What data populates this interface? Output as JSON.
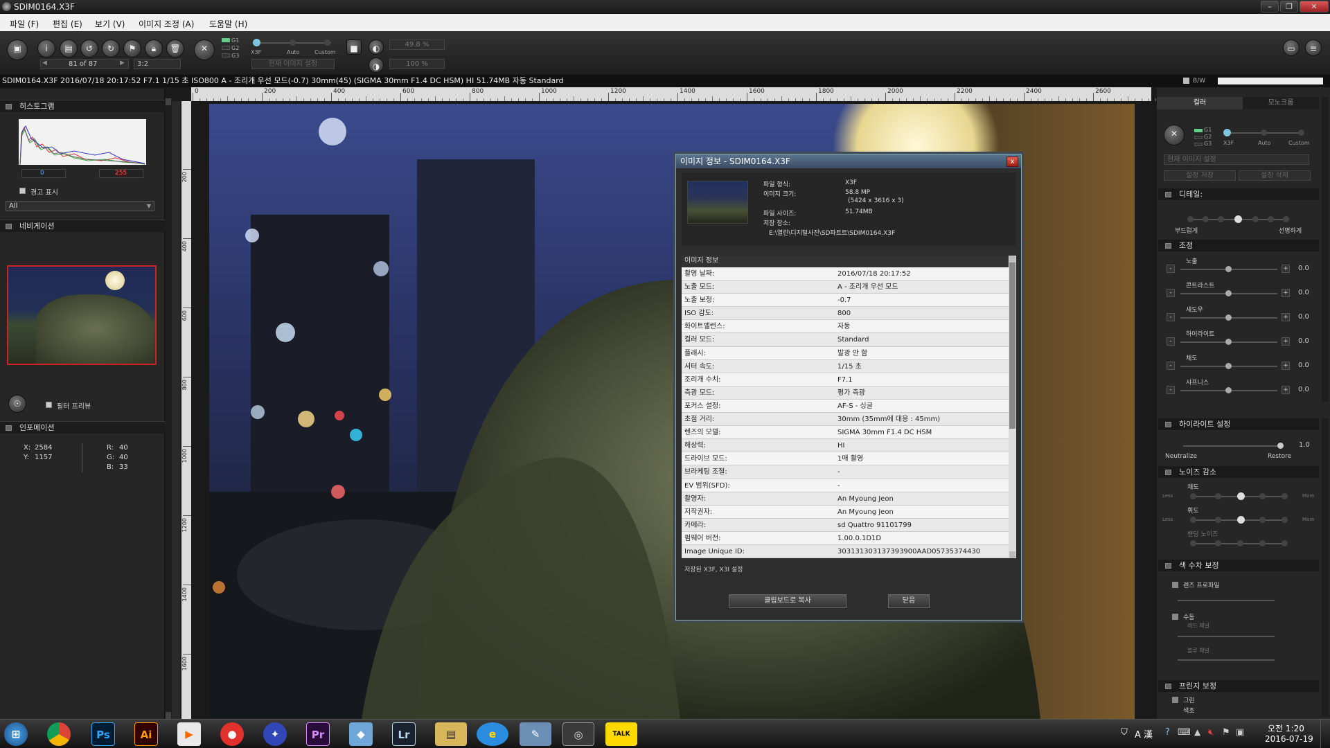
{
  "window": {
    "title": "SDIM0164.X3F"
  },
  "menu": [
    "파일 (F)",
    "편집 (E)",
    "보기 (V)",
    "이미지 조정 (A)",
    "도움말 (H)"
  ],
  "toolbar": {
    "counter": "81 of 87",
    "ratio": "3:2",
    "g_labels": [
      "G1",
      "G2",
      "G3"
    ],
    "mode_labels": [
      "X3F",
      "Auto",
      "Custom"
    ],
    "preset": "현재 이미지 설정",
    "zoom1": "49.8 %",
    "zoom2": "100 %"
  },
  "infostrip": "SDIM0164.X3F 2016/07/18 20:17:52 F7.1 1/15 초 ISO800 A - 조리개 우선 모드(-0.7) 30mm(45) (SIGMA 30mm F1.4 DC HSM) HI 51.74MB 자동 Standard",
  "infostrip_right": "B/W",
  "left": {
    "histogram_title": "히스토그램",
    "hist_min": "0",
    "hist_max": "255",
    "warning_label": "경고 표시",
    "channel_select": "All",
    "navigation_title": "네비게이션",
    "filter_preview": "필터 프리뷰",
    "information_title": "인포메이션",
    "x_label": "X:",
    "x": "2584",
    "y_label": "Y:",
    "y": "1157",
    "r_label": "R:",
    "r": "40",
    "g_label": "G:",
    "g": "40",
    "b_label": "B:",
    "b": "33"
  },
  "ruler": {
    "top": [
      "0",
      "200",
      "400",
      "600",
      "800",
      "1000",
      "1200",
      "1400",
      "1600",
      "1800",
      "2000",
      "2200",
      "2400",
      "2600"
    ],
    "left": [
      "200",
      "400",
      "600",
      "800",
      "1000",
      "1200",
      "1400",
      "1600"
    ]
  },
  "right": {
    "tab_color": "컬러",
    "tab_mono": "모노크롬",
    "preset": "현재 이미지 설정",
    "save_btn": "설정 저장",
    "delete_btn": "설정 삭제",
    "detail_title": "디테일:",
    "soft_label": "부드럽게",
    "sharp_label": "선명하게",
    "adjust_title": "조정",
    "sliders": [
      {
        "label": "노출",
        "value": "0.0"
      },
      {
        "label": "콘트라스트",
        "value": "0.0"
      },
      {
        "label": "섀도우",
        "value": "0.0"
      },
      {
        "label": "하이라이트",
        "value": "0.0"
      },
      {
        "label": "채도",
        "value": "0.0"
      },
      {
        "label": "샤프니스",
        "value": "0.0"
      }
    ],
    "highlight_title": "하이라이트 설정",
    "highlight_value": "1.0",
    "neutralize": "Neutralize",
    "restore": "Restore",
    "noise_title": "노이즈 감소",
    "noise_chroma": "채도",
    "noise_luma": "휘도",
    "noise_banding": "밴딩 노이즈",
    "less": "Less",
    "more": "More",
    "color_corr_title": "색 수차 보정",
    "lens_profile": "렌즈 프로파일",
    "manual": "수동",
    "red_channel": "레드 채널",
    "blue_channel": "블루 채널",
    "fringe_title": "프린지 보정",
    "green": "그린",
    "color_word": "색조"
  },
  "dialog": {
    "title": "이미지 정보 - SDIM0164.X3F",
    "close": "x",
    "format_label": "파일 형식:",
    "format": "X3F",
    "size_label": "이미지 크기:",
    "size": "58.8 MP",
    "size2": "(5424 x 3616 x 3)",
    "filesize_label": "파일 사이즈:",
    "filesize": "51.74MB",
    "location_label": "저장 장소:",
    "location": "E:\\열린\\디지털사진\\SD파트트\\SDIM0164.X3F",
    "section": "이미지 정보",
    "rows": [
      {
        "k": "촬영 날짜:",
        "v": "2016/07/18 20:17:52"
      },
      {
        "k": "노출 모드:",
        "v": "A - 조리개 우선 모드"
      },
      {
        "k": "노출 보정:",
        "v": "-0.7"
      },
      {
        "k": "ISO 감도:",
        "v": "800"
      },
      {
        "k": "화이트밸런스:",
        "v": "자동"
      },
      {
        "k": "컬러 모드:",
        "v": "Standard"
      },
      {
        "k": "플래시:",
        "v": "발광 안 함"
      },
      {
        "k": "셔터 속도:",
        "v": "1/15 초"
      },
      {
        "k": "조리개 수치:",
        "v": "F7.1"
      },
      {
        "k": "측광 모드:",
        "v": "평가 측광"
      },
      {
        "k": "포커스 설정:",
        "v": "AF-S - 싱글"
      },
      {
        "k": "초점 거리:",
        "v": "30mm (35mm에 대응 : 45mm)"
      },
      {
        "k": "렌즈의 모델:",
        "v": "SIGMA 30mm F1.4 DC HSM"
      },
      {
        "k": "해상력:",
        "v": "HI"
      },
      {
        "k": "드라이브 모드:",
        "v": "1매 촬영"
      },
      {
        "k": "브라케팅 조절:",
        "v": "-"
      },
      {
        "k": "EV 범위(SFD):",
        "v": "-"
      },
      {
        "k": "촬영자:",
        "v": "An Myoung Jeon"
      },
      {
        "k": "저작권자:",
        "v": "An Myoung Jeon"
      },
      {
        "k": "카메라:",
        "v": "sd Quattro 91101799"
      },
      {
        "k": "펌웨어 버전:",
        "v": "1.00.0.1D1D"
      },
      {
        "k": "Image Unique ID:",
        "v": "303131303137393900AAD05735374430"
      }
    ],
    "footer_label": "저장된 X3F, X3I 설정",
    "copy_btn": "클립보드로 복사",
    "ok_btn": "닫음"
  },
  "taskbar": {
    "apps": [
      "Ps",
      "Ai",
      "Pr",
      "Lr",
      "TALK"
    ],
    "ime": "A 漢",
    "time": "오전 1:20",
    "date": "2016-07-19"
  }
}
